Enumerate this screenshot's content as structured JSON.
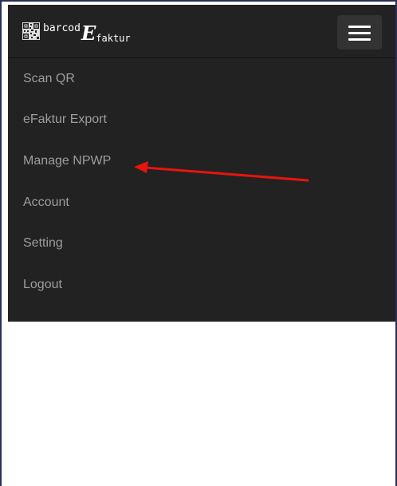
{
  "brand": {
    "prefix": "barcod",
    "big_letter": "E",
    "suffix": "faktur",
    "icon": "qr-code-icon"
  },
  "toggle": {
    "icon": "hamburger-menu-icon"
  },
  "menu": {
    "items": [
      {
        "label": "Scan QR"
      },
      {
        "label": "eFaktur Export"
      },
      {
        "label": "Manage NPWP"
      },
      {
        "label": "Account"
      },
      {
        "label": "Setting"
      },
      {
        "label": "Logout"
      }
    ]
  },
  "annotation": {
    "arrow_color": "#e8140f",
    "icon": "red-arrow-annotation"
  },
  "colors": {
    "navbar_bg": "#222222",
    "menu_text": "#9d9d9d",
    "frame_border": "#2a2f55"
  }
}
